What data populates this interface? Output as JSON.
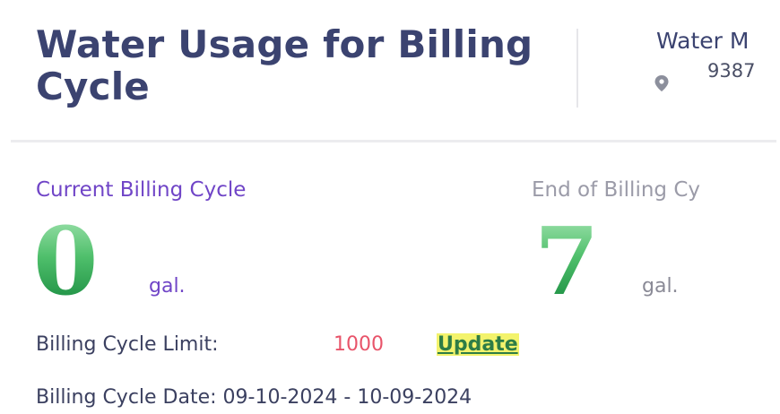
{
  "header": {
    "title": "Water Usage for Billing Cycle",
    "meter": {
      "name": "Water M",
      "number": "9387"
    }
  },
  "usage": {
    "current": {
      "label": "Current Billing Cycle",
      "value": "0",
      "unit": "gal."
    },
    "end": {
      "label": "End of Billing Cy",
      "value": "7",
      "unit": "gal."
    }
  },
  "billing": {
    "limit_label": "Billing Cycle Limit:",
    "limit_value": "1000",
    "update_label": "Update",
    "date_text": "Billing Cycle Date: 09-10-2024 - 10-09-2024"
  },
  "colors": {
    "title": "#3b4370",
    "accent_purple": "#7045c7",
    "limit_red": "#e8546a",
    "usage_green": "#3fb262",
    "update_highlight": "#f3f36c"
  },
  "icons": {
    "location": "map-pin-icon"
  }
}
